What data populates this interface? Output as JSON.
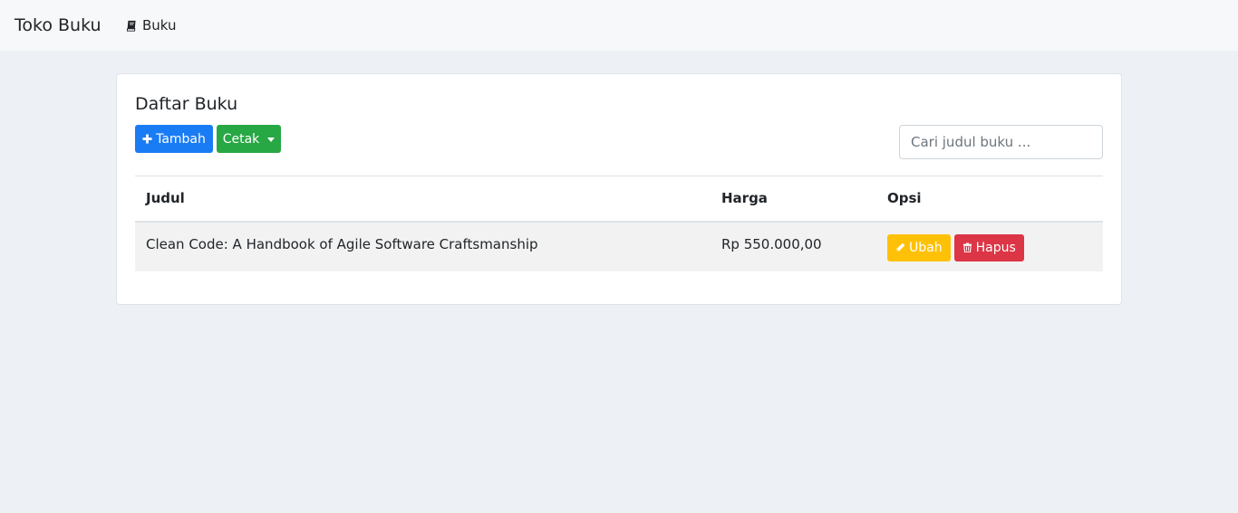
{
  "navbar": {
    "brand": "Toko Buku",
    "nav_item": {
      "label": "Buku",
      "icon": "book-icon"
    }
  },
  "card": {
    "title": "Daftar Buku",
    "add_button": {
      "label": "Tambah",
      "icon": "plus-icon",
      "color": "#1a7cf5"
    },
    "print_button": {
      "label": "Cetak",
      "color": "#28a745"
    },
    "search": {
      "placeholder": "Cari judul buku ...",
      "value": ""
    }
  },
  "table": {
    "headers": {
      "title": "Judul",
      "price": "Harga",
      "options": "Opsi"
    },
    "rows": [
      {
        "title": "Clean Code: A Handbook of Agile Software Craftsmanship",
        "price": "Rp 550.000,00",
        "edit_label": "Ubah",
        "delete_label": "Hapus"
      }
    ]
  },
  "colors": {
    "edit": "#ffc107",
    "delete": "#dc3545",
    "background": "#edf1f5"
  }
}
